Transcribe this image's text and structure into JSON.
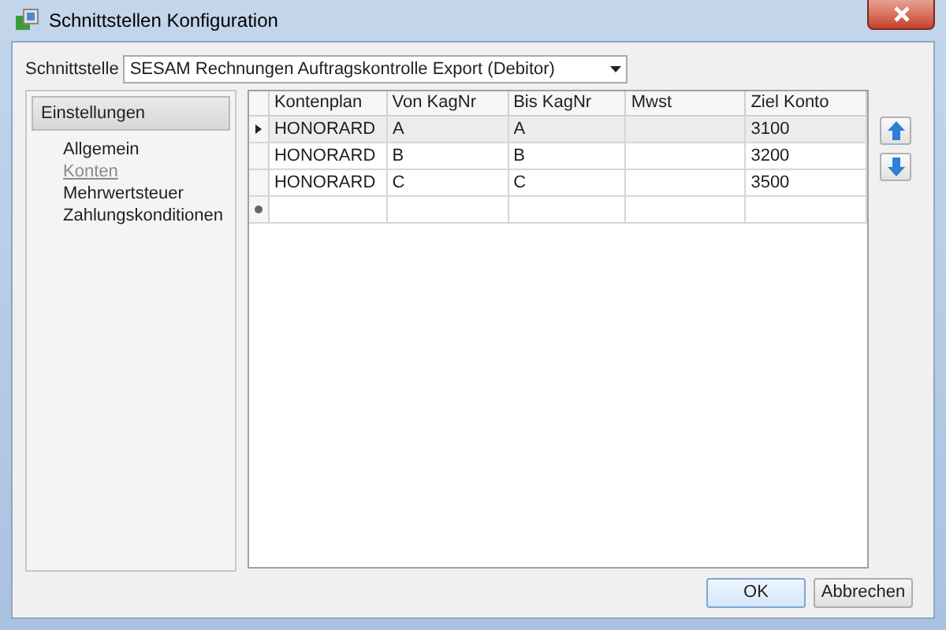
{
  "window": {
    "title": "Schnittstellen Konfiguration"
  },
  "interface_field": {
    "label": "Schnittstelle",
    "value": "SESAM Rechnungen Auftragskontrolle Export (Debitor)"
  },
  "sidebar": {
    "header": "Einstellungen",
    "items": [
      {
        "label": "Allgemein",
        "selected": false
      },
      {
        "label": "Konten",
        "selected": true
      },
      {
        "label": "Mehrwertsteuer",
        "selected": false
      },
      {
        "label": "Zahlungskonditionen",
        "selected": false
      }
    ]
  },
  "table": {
    "columns": [
      "Kontenplan",
      "Von KagNr",
      "Bis KagNr",
      "Mwst",
      "Ziel Konto"
    ],
    "rows": [
      {
        "selected": true,
        "cells": [
          "HONORARD",
          "A",
          "A",
          "",
          "3100"
        ]
      },
      {
        "selected": false,
        "cells": [
          "HONORARD",
          "B",
          "B",
          "",
          "3200"
        ]
      },
      {
        "selected": false,
        "cells": [
          "HONORARD",
          "C",
          "C",
          "",
          "3500"
        ]
      }
    ]
  },
  "buttons": [
    {
      "label": "OK",
      "kind": "default"
    },
    {
      "label": "Abbrechen",
      "kind": "normal"
    }
  ]
}
